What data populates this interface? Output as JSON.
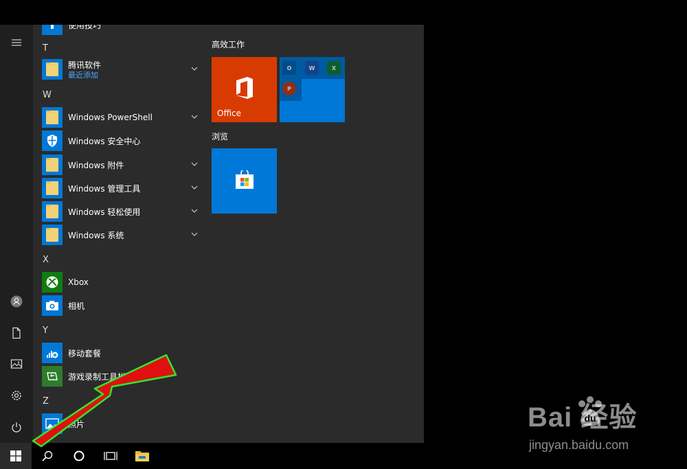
{
  "app_list": {
    "top_item": "使用技巧",
    "sections": [
      {
        "letter": "T"
      },
      {
        "letter": "W"
      },
      {
        "letter": "X"
      },
      {
        "letter": "Y"
      },
      {
        "letter": "Z"
      }
    ],
    "items": [
      {
        "label": "腾讯软件",
        "sub": "最近添加"
      },
      {
        "label": "Windows PowerShell"
      },
      {
        "label": "Windows 安全中心"
      },
      {
        "label": "Windows 附件"
      },
      {
        "label": "Windows 管理工具"
      },
      {
        "label": "Windows 轻松使用"
      },
      {
        "label": "Windows 系统"
      },
      {
        "label": "Xbox"
      },
      {
        "label": "相机"
      },
      {
        "label": "移动套餐"
      },
      {
        "label": "游戏录制工具栏"
      },
      {
        "label": "照片"
      }
    ]
  },
  "tiles": {
    "group1": "高效工作",
    "office_label": "Office",
    "group2": "浏览",
    "mini_outlook": "O",
    "mini_word": "W",
    "mini_excel": "X",
    "mini_ppt": "P"
  },
  "icons": {
    "rail": [
      "hamburger-icon",
      "user-icon",
      "document-icon",
      "pictures-icon",
      "settings-icon",
      "power-icon"
    ],
    "taskbar": [
      "windows-logo-icon",
      "search-icon",
      "cortana-icon",
      "task-view-icon",
      "file-explorer-icon"
    ]
  },
  "colors": {
    "accent": "#0078d7",
    "office": "#d83b01",
    "annotation_arrow": "#e01010",
    "annotation_outline": "#2ee82e"
  },
  "watermark": {
    "logo": "Bai  经验",
    "url": "jingyan.baidu.com"
  }
}
